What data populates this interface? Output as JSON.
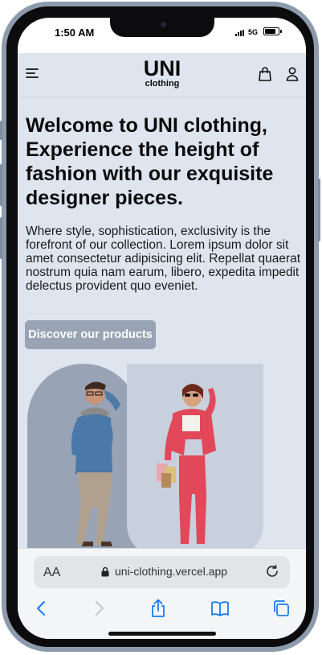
{
  "status": {
    "time": "1:50 AM",
    "network": "5G"
  },
  "header": {
    "brand": "UNI",
    "brand_sub": "clothing",
    "icons": [
      "menu-icon",
      "shopping-bag-icon",
      "user-icon"
    ]
  },
  "hero": {
    "title": "Welcome to UNI clothing, Experience the height of fashion with our exquisite designer pieces.",
    "text": "Where style, sophistication, exclusivity is the forefront of our collection. Lorem ipsum dolor sit amet consectetur adipisicing elit. Repellat quaerat nostrum quia nam earum, libero, expedita impedit delectus provident quo eveniet.",
    "cta": "Discover our products"
  },
  "browser": {
    "text_size_label": "AA",
    "url": "uni-clothing.vercel.app",
    "toolbar_icons": [
      "back-icon",
      "forward-icon",
      "share-icon",
      "bookmarks-icon",
      "tabs-icon"
    ]
  },
  "colors": {
    "page_bg": "#dfe5ee",
    "cta_bg": "#98a3b3",
    "arch_dark": "#98a4b6",
    "arch_light": "#c7d0dc",
    "accent_blue": "#1a7cf5"
  }
}
